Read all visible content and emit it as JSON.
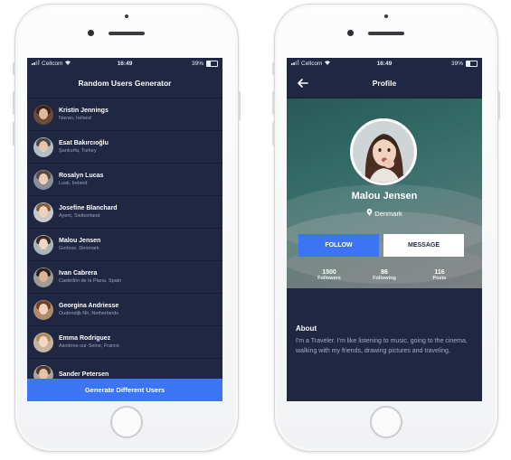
{
  "status_bar": {
    "carrier": "Cellcom",
    "time": "16:49",
    "battery": "39%",
    "battery_level": 0.39
  },
  "list_screen": {
    "title": "Random Users Generator",
    "users": [
      {
        "name": "Kristin Jennings",
        "location": "Navan, Ireland"
      },
      {
        "name": "Esat Bakırcıoğlu",
        "location": "Şanlıurfa, Turkey"
      },
      {
        "name": "Rosalyn Lucas",
        "location": "Lusk, Ireland"
      },
      {
        "name": "Josefine Blanchard",
        "location": "Ayent, Switzerland"
      },
      {
        "name": "Malou Jensen",
        "location": "Gerlese, Denmark"
      },
      {
        "name": "Ivan Cabrera",
        "location": "Castellón de la Plana, Spain"
      },
      {
        "name": "Georgina Andriesse",
        "location": "Oudendijk Nh, Netherlands"
      },
      {
        "name": "Emma Rodriguez",
        "location": "Asnières-sur-Seine, France"
      },
      {
        "name": "Sander Petersen",
        "location": ""
      }
    ],
    "generate_button": "Generate Different Users"
  },
  "profile_screen": {
    "title": "Profile",
    "name": "Malou Jensen",
    "location": "Denmark",
    "follow_button": "FOLLOW",
    "message_button": "MESSAGE",
    "stats": [
      {
        "value": "1500",
        "label": "Followers"
      },
      {
        "value": "86",
        "label": "Following"
      },
      {
        "value": "116",
        "label": "Posts"
      }
    ],
    "about_title": "About",
    "about_text": "I'm a Traveler. I'm like listening to music, going to the cinema, walking with my friends, drawing pictures and traveling."
  },
  "colors": {
    "screen_bg": "#1f2742",
    "accent": "#3c74f6",
    "muted_text": "#9aa3bd"
  },
  "icons": {
    "back": "arrow-left-icon",
    "location": "map-pin-icon",
    "wifi": "wifi-icon",
    "signal": "signal-icon",
    "battery": "battery-icon"
  }
}
